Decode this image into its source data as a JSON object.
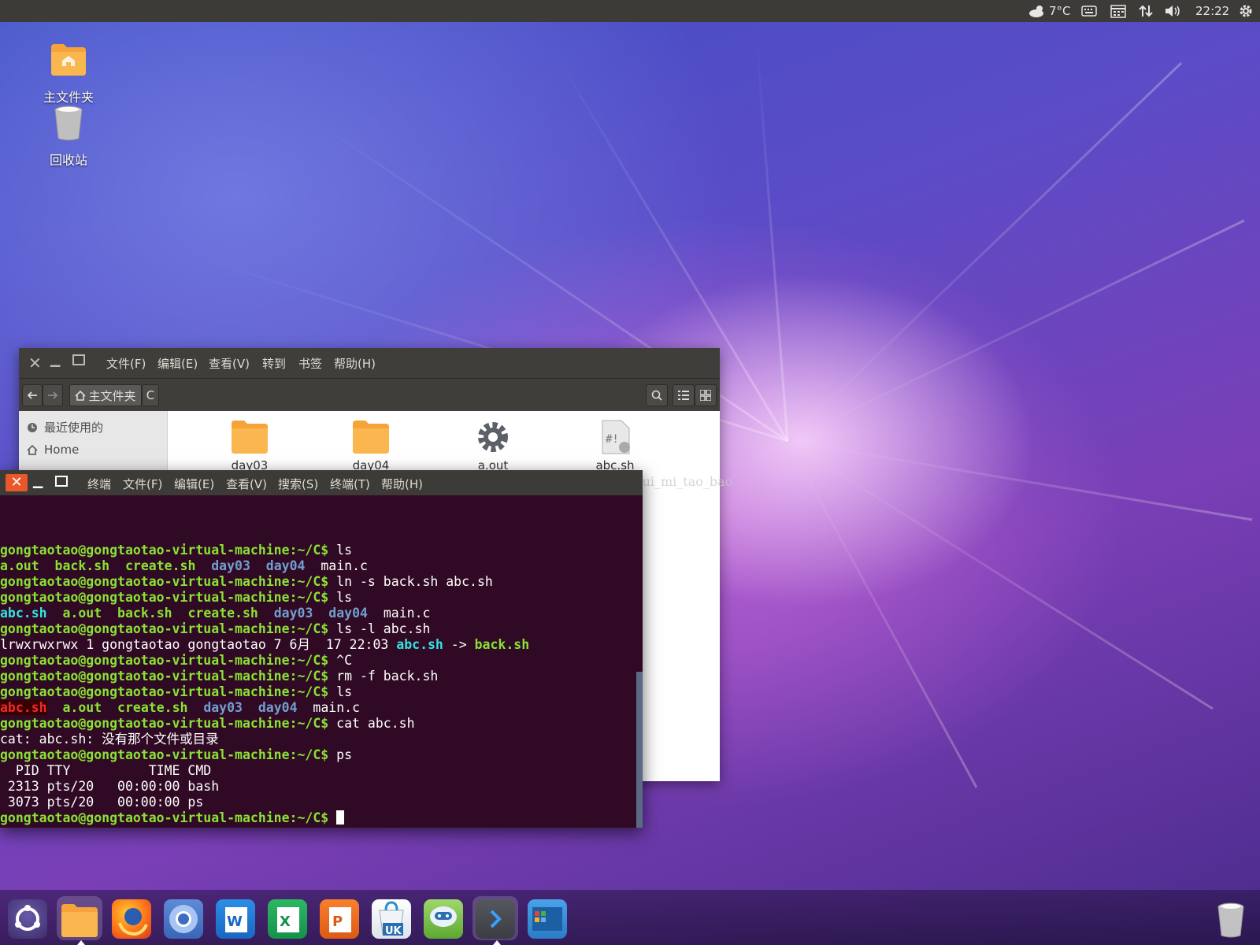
{
  "top_panel": {
    "weather_icon": "cloud-sun-icon",
    "temperature": "7°C",
    "clock": "22:22",
    "indicators": [
      "keyboard-icon",
      "calendar-icon",
      "network-updown-icon",
      "volume-icon",
      "gear-icon"
    ]
  },
  "desktop": {
    "icons": [
      {
        "label": "主文件夹",
        "icon": "home-folder-icon"
      },
      {
        "label": "回收站",
        "icon": "trash-icon"
      }
    ]
  },
  "file_manager": {
    "menu": [
      "文件(F)",
      "编辑(E)",
      "查看(V)",
      "转到",
      "书签",
      "帮助(H)"
    ],
    "breadcrumb": "主文件夹",
    "breadcrumb_next": "C",
    "sidebar": [
      {
        "label": "最近使用的",
        "icon": "clock-icon"
      },
      {
        "label": "Home",
        "icon": "home-icon"
      }
    ],
    "files": [
      {
        "name": "day03",
        "icon": "folder-icon"
      },
      {
        "name": "day04",
        "icon": "folder-icon"
      },
      {
        "name": "a.out",
        "icon": "gear-executable-icon"
      },
      {
        "name": "abc.sh",
        "icon": "script-file-icon"
      }
    ]
  },
  "terminal": {
    "menu": [
      "终端",
      "文件(F)",
      "编辑(E)",
      "查看(V)",
      "搜索(S)",
      "终端(T)",
      "帮助(H)"
    ],
    "prompt": "gongtaotao@gongtaotao-virtual-machine:~/C$",
    "commands": {
      "c1": "ls",
      "c2": "ln -s back.sh abc.sh",
      "c3": "ls",
      "c4": "ls -l abc.sh",
      "c5": "^C",
      "c6": "rm -f back.sh",
      "c7": "ls",
      "c8": "cat abc.sh",
      "c9": "ps"
    },
    "ls1": {
      "a": "a.out",
      "b": "back.sh",
      "c": "create.sh",
      "d": "day03",
      "e": "day04",
      "f": "main.c"
    },
    "ls2": {
      "a": "abc.sh",
      "b": "a.out",
      "c": "back.sh",
      "d": "create.sh",
      "e": "day03",
      "f": "day04",
      "g": "main.c"
    },
    "lsl": {
      "meta": "lrwxrwxrwx 1 gongtaotao gongtaotao 7 6月  17 22:03 ",
      "link": "abc.sh",
      "arrow": " -> ",
      "target": "back.sh"
    },
    "ls3": {
      "a": "abc.sh",
      "b": "a.out",
      "c": "create.sh",
      "d": "day03",
      "e": "day04",
      "f": "main.c"
    },
    "cat_error": "cat: abc.sh: 没有那个文件或目录",
    "ps_header": "  PID TTY          TIME CMD",
    "ps_row1": " 2313 pts/20   00:00:00 bash",
    "ps_row2": " 3073 pts/20   00:00:00 ps"
  },
  "watermark": "http://blog.csdn.net/Shui_mi_tao_bao",
  "dock": {
    "items": [
      "ubuntu-logo-icon",
      "files-icon",
      "firefox-icon",
      "chromium-icon",
      "wps-writer-icon",
      "wps-spreadsheets-icon",
      "wps-presentation-icon",
      "ubuntu-kylin-software-center-icon",
      "ubuntu-kylin-assistant-icon",
      "terminal-icon",
      "workspace-switcher-icon"
    ],
    "trash": "trash-icon"
  },
  "colors": {
    "terminal_bg": "#300a24",
    "prompt_green": "#8ae234",
    "dir_blue": "#729fcf",
    "link_cyan": "#34e2e2",
    "broken_red": "#ef2929",
    "panel_dark": "#3c3b37",
    "close_orange": "#e9572b"
  }
}
